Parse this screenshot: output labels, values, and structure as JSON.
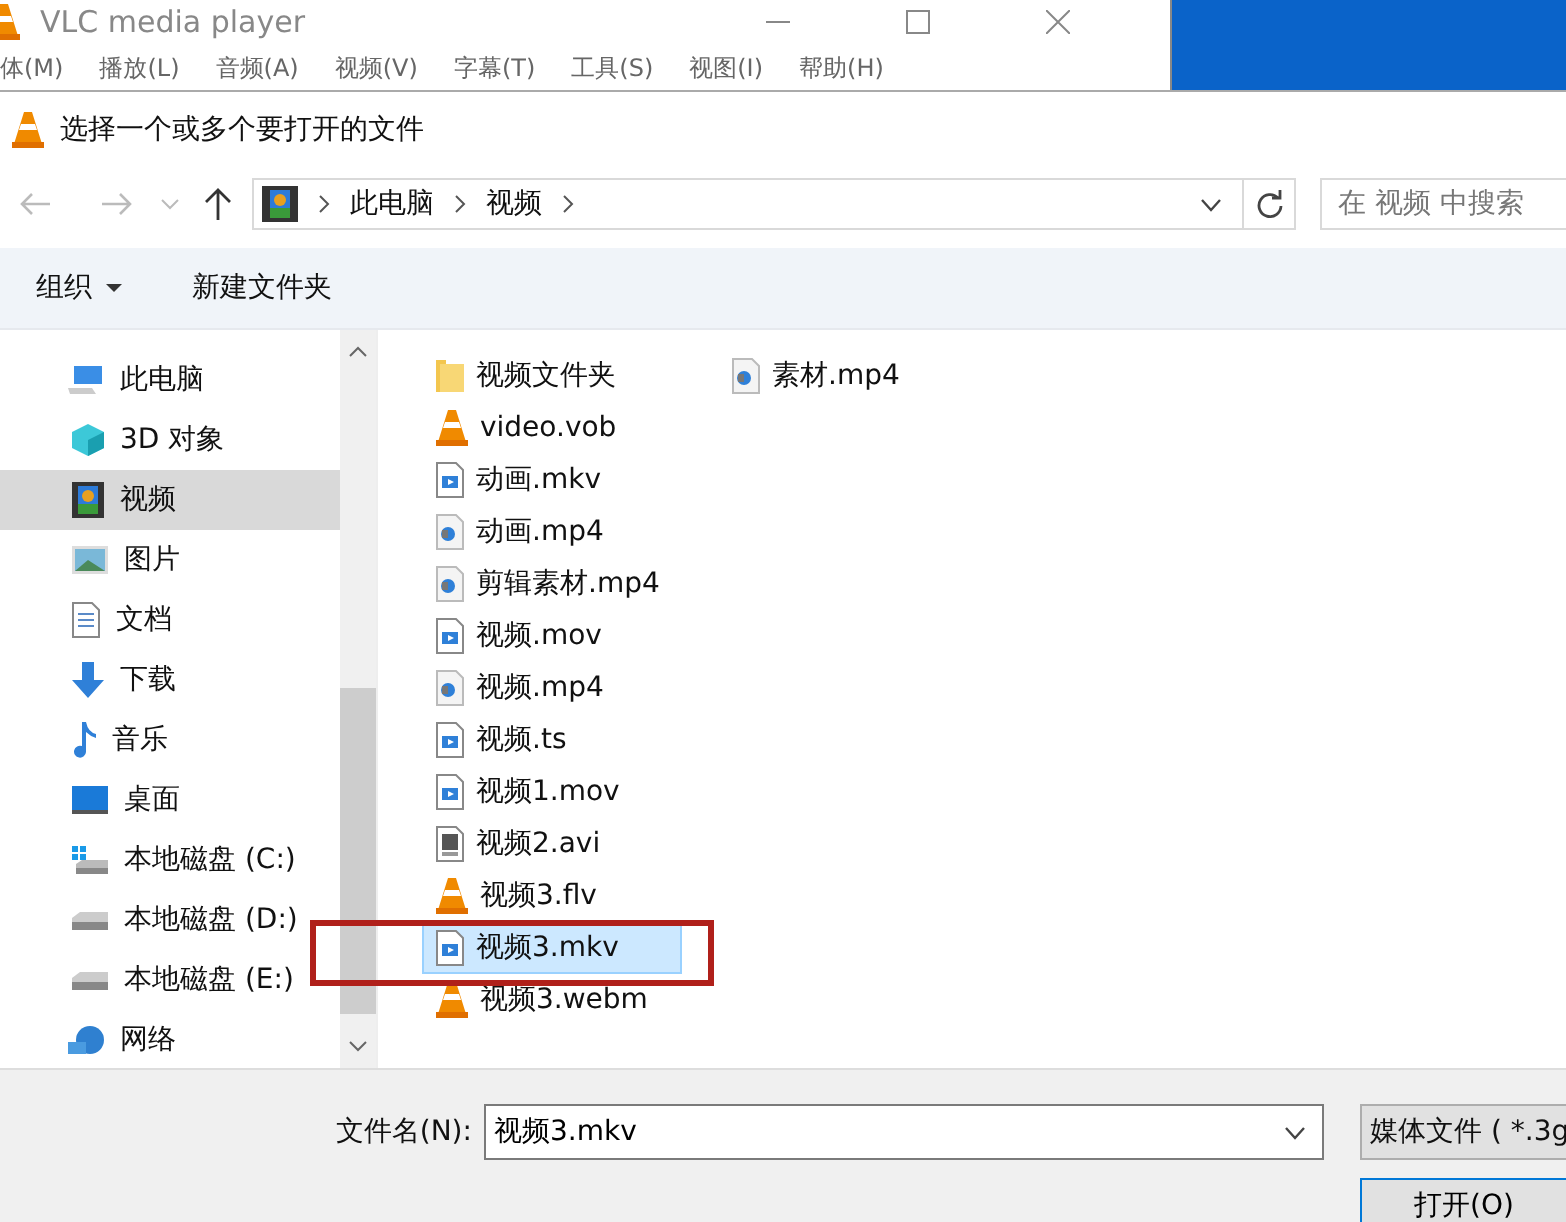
{
  "background_window": {
    "title": "VLC media player",
    "menu": [
      "体(M)",
      "播放(L)",
      "音频(A)",
      "视频(V)",
      "字幕(T)",
      "工具(S)",
      "视图(I)",
      "帮助(H)"
    ]
  },
  "dialog": {
    "title": "选择一个或多个要打开的文件",
    "address": {
      "path": [
        "此电脑",
        "视频"
      ]
    },
    "search": {
      "placeholder": "在 视频 中搜索"
    },
    "toolbar": {
      "organize": "组织",
      "new_folder": "新建文件夹"
    },
    "nav": [
      {
        "label": "此电脑",
        "kind": "pc",
        "selected": false,
        "children": [
          {
            "label": "3D 对象",
            "kind": "cube",
            "selected": false
          },
          {
            "label": "视频",
            "kind": "film",
            "selected": true
          },
          {
            "label": "图片",
            "kind": "image",
            "selected": false
          },
          {
            "label": "文档",
            "kind": "doc",
            "selected": false
          },
          {
            "label": "下载",
            "kind": "download",
            "selected": false
          },
          {
            "label": "音乐",
            "kind": "music",
            "selected": false
          },
          {
            "label": "桌面",
            "kind": "desktop",
            "selected": false
          },
          {
            "label": "本地磁盘 (C:)",
            "kind": "winDrive",
            "selected": false
          },
          {
            "label": "本地磁盘 (D:)",
            "kind": "drive",
            "selected": false
          },
          {
            "label": "本地磁盘 (E:)",
            "kind": "drive",
            "selected": false
          }
        ]
      },
      {
        "label": "网络",
        "kind": "network",
        "selected": false
      }
    ],
    "files": [
      [
        {
          "name": "视频文件夹",
          "kind": "folder",
          "selected": false
        },
        {
          "name": "video.vob",
          "kind": "vlc",
          "selected": false
        },
        {
          "name": "动画.mkv",
          "kind": "video",
          "selected": false
        },
        {
          "name": "动画.mp4",
          "kind": "media",
          "selected": false
        },
        {
          "name": "剪辑素材.mp4",
          "kind": "media",
          "selected": false
        },
        {
          "name": "视频.mov",
          "kind": "video",
          "selected": false
        },
        {
          "name": "视频.mp4",
          "kind": "media",
          "selected": false
        },
        {
          "name": "视频.ts",
          "kind": "video",
          "selected": false
        },
        {
          "name": "视频1.mov",
          "kind": "video",
          "selected": false
        },
        {
          "name": "视频2.avi",
          "kind": "avi",
          "selected": false
        },
        {
          "name": "视频3.flv",
          "kind": "vlc",
          "selected": false
        },
        {
          "name": "视频3.mkv",
          "kind": "video",
          "selected": true
        },
        {
          "name": "视频3.webm",
          "kind": "vlc",
          "selected": false
        }
      ],
      [
        {
          "name": "素材.mp4",
          "kind": "media",
          "selected": false
        }
      ]
    ],
    "filename_label": "文件名(N):",
    "filename": "视频3.mkv",
    "filter": "媒体文件 ( *.3g",
    "open_button": "打开(O)"
  }
}
